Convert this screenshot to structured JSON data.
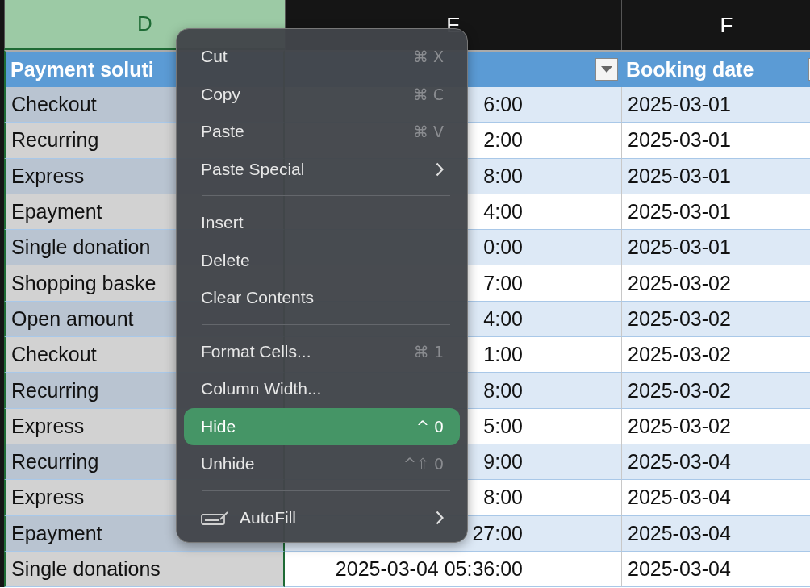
{
  "columns": [
    {
      "letter": "D",
      "selected": true
    },
    {
      "letter": "E",
      "selected": false
    },
    {
      "letter": "F",
      "selected": false
    }
  ],
  "headers": [
    {
      "text": "Payment soluti",
      "filter": false
    },
    {
      "filter": true
    },
    {
      "text": "Booking date",
      "filter": true
    }
  ],
  "rows": [
    {
      "payment": "Checkout",
      "time": "6:00",
      "date": "2025-03-01"
    },
    {
      "payment": "Recurring",
      "time": "2:00",
      "date": "2025-03-01"
    },
    {
      "payment": "Express",
      "time": "8:00",
      "date": "2025-03-01"
    },
    {
      "payment": "Epayment",
      "time": "4:00",
      "date": "2025-03-01"
    },
    {
      "payment": "Single donation",
      "time": "0:00",
      "date": "2025-03-01"
    },
    {
      "payment": "Shopping baske",
      "time": "7:00",
      "date": "2025-03-02"
    },
    {
      "payment": "Open amount",
      "time": "4:00",
      "date": "2025-03-02"
    },
    {
      "payment": "Checkout",
      "time": "1:00",
      "date": "2025-03-02"
    },
    {
      "payment": "Recurring",
      "time": "8:00",
      "date": "2025-03-02"
    },
    {
      "payment": "Express",
      "time": "5:00",
      "date": "2025-03-02"
    },
    {
      "payment": "Recurring",
      "time": "9:00",
      "date": "2025-03-04"
    },
    {
      "payment": "Express",
      "time": "8:00",
      "date": "2025-03-04"
    },
    {
      "payment": "Epayment",
      "time": "27:00",
      "date": "2025-03-04"
    },
    {
      "payment": "Single donations",
      "time": "2025-03-04 05:36:00",
      "date": "2025-03-04"
    }
  ],
  "context_menu": {
    "items": [
      {
        "kind": "item",
        "label": "Cut",
        "shortcut": "⌘ X",
        "submenu": false,
        "selected": false
      },
      {
        "kind": "item",
        "label": "Copy",
        "shortcut": "⌘ C",
        "submenu": false,
        "selected": false
      },
      {
        "kind": "item",
        "label": "Paste",
        "shortcut": "⌘ V",
        "submenu": false,
        "selected": false
      },
      {
        "kind": "item",
        "label": "Paste Special",
        "submenu": true,
        "selected": false
      },
      {
        "kind": "separator"
      },
      {
        "kind": "item",
        "label": "Insert",
        "submenu": false,
        "selected": false
      },
      {
        "kind": "item",
        "label": "Delete",
        "submenu": false,
        "selected": false
      },
      {
        "kind": "item",
        "label": "Clear Contents",
        "submenu": false,
        "selected": false
      },
      {
        "kind": "separator"
      },
      {
        "kind": "item",
        "label": "Format Cells...",
        "shortcut": "⌘ 1",
        "submenu": false,
        "selected": false
      },
      {
        "kind": "item",
        "label": "Column Width...",
        "submenu": false,
        "selected": false
      },
      {
        "kind": "item",
        "label": "Hide",
        "shortcut": "^ 0",
        "submenu": false,
        "selected": true
      },
      {
        "kind": "item",
        "label": "Unhide",
        "shortcut": "^⇧ 0",
        "submenu": false,
        "selected": false
      },
      {
        "kind": "separator"
      },
      {
        "kind": "icon_item",
        "label": "AutoFill",
        "submenu": true,
        "selected": false
      }
    ]
  }
}
